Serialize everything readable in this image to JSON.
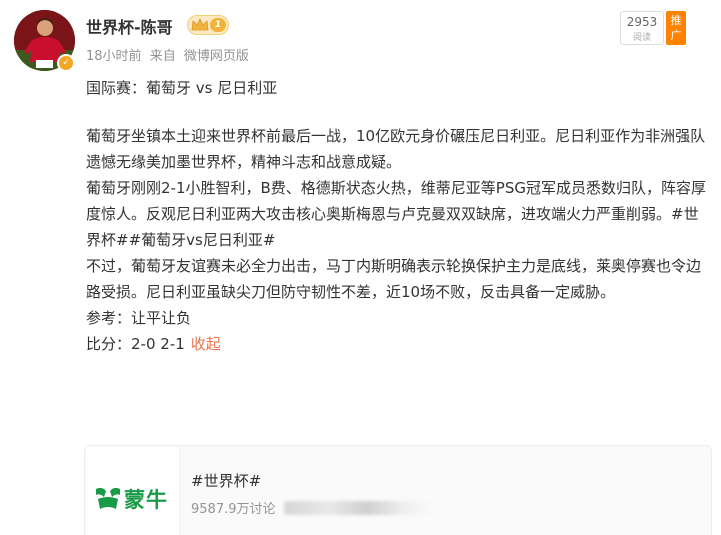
{
  "post": {
    "username": "世界杯-陈哥",
    "level": "1",
    "time": "18小时前",
    "source_prefix": "来自",
    "source": "微博网页版",
    "views": "2953",
    "views_label": "阅读",
    "promote": "推广"
  },
  "content": {
    "title": "国际赛：葡萄牙 vs 尼日利亚",
    "p1": "葡萄牙坐镇本土迎来世界杯前最后一战，10亿欧元身价碾压尼日利亚。尼日利亚作为非洲强队遗憾无缘美加墨世界杯，精神斗志和战意成疑。",
    "p2": "葡萄牙刚刚2-1小胜智利，B费、格德斯状态火热，维蒂尼亚等PSG冠军成员悉数归队，阵容厚度惊人。反观尼日利亚两大攻击核心奥斯梅恩与卢克曼双双缺席，进攻端火力严重削弱。",
    "hashtag1": "#世界杯#",
    "hashtag2": "#葡萄牙vs尼日利亚#",
    "p3": "不过，葡萄牙友谊赛未必全力出击，马丁内斯明确表示轮换保护主力是底线，莱奥停赛也令边路受损。尼日利亚虽缺尖刀但防守韧性不差，近10场不败，反击具备一定威胁。",
    "reference": "参考：让平让负",
    "score": "比分：2-0  2-1",
    "collapse": "收起"
  },
  "card": {
    "brand": "蒙牛",
    "title": "#世界杯#",
    "subtitle": "9587.9万讨论"
  },
  "colors": {
    "accent": "#eb7350",
    "brand_green": "#1a9b47",
    "promote": "#ff8200"
  }
}
